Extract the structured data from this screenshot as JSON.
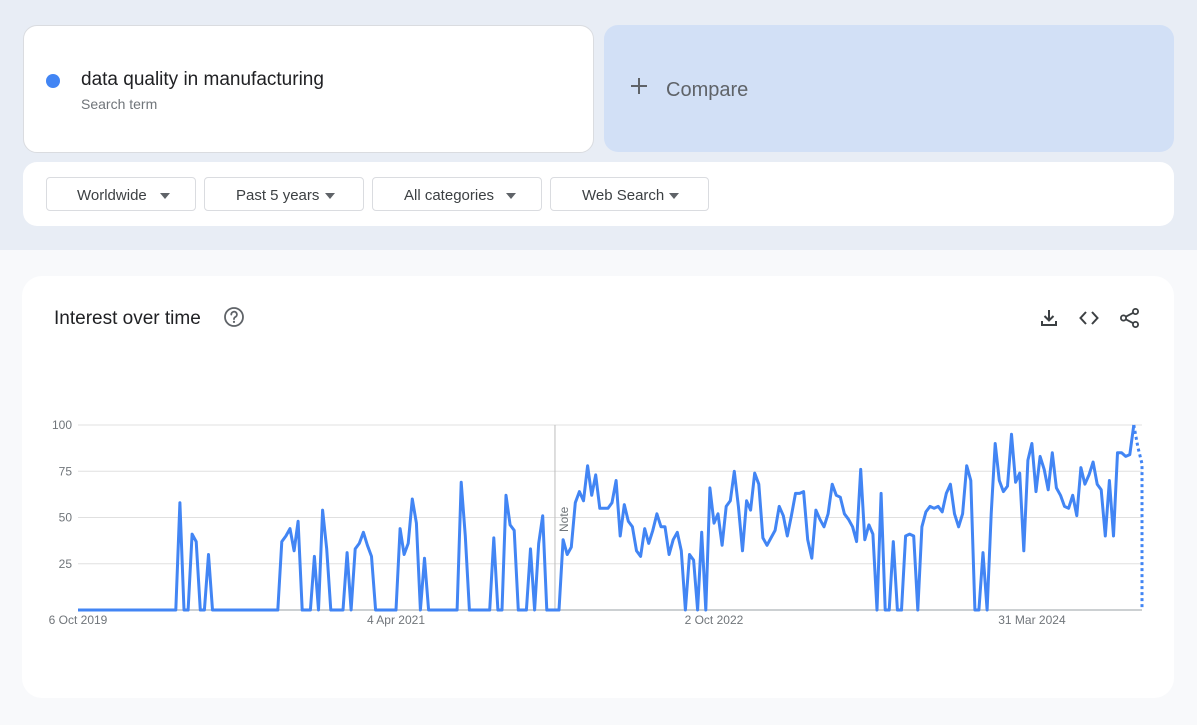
{
  "search_term": {
    "name": "data quality in manufacturing",
    "kind": "Search term",
    "color": "#4285f4"
  },
  "compare": {
    "label": "Compare"
  },
  "filters": [
    {
      "label": "Worldwide"
    },
    {
      "label": "Past 5 years"
    },
    {
      "label": "All categories"
    },
    {
      "label": "Web Search"
    }
  ],
  "chart_panel": {
    "title": "Interest over time",
    "icons": [
      "help-icon",
      "download-icon",
      "embed-code-icon",
      "share-icon"
    ]
  },
  "chart_data": {
    "type": "line",
    "ylim": [
      0,
      100
    ],
    "yticks": [
      "100",
      "75",
      "50",
      "25"
    ],
    "xticks": [
      {
        "label": "6 Oct 2019",
        "index": 0
      },
      {
        "label": "4 Apr 2021",
        "index": 78
      },
      {
        "label": "2 Oct 2022",
        "index": 156
      },
      {
        "label": "31 Mar 2024",
        "index": 234
      }
    ],
    "note": {
      "label": "Note",
      "index": 117
    },
    "partial_from_index": 259,
    "grid": true,
    "series": [
      {
        "color": "#4285f4",
        "values": [
          0,
          0,
          0,
          0,
          0,
          0,
          0,
          0,
          0,
          0,
          0,
          0,
          0,
          0,
          0,
          0,
          0,
          0,
          0,
          0,
          0,
          0,
          0,
          0,
          0,
          58,
          0,
          0,
          41,
          37,
          0,
          0,
          30,
          0,
          0,
          0,
          0,
          0,
          0,
          0,
          0,
          0,
          0,
          0,
          0,
          0,
          0,
          0,
          0,
          0,
          37,
          40,
          44,
          32,
          48,
          0,
          0,
          0,
          29,
          0,
          54,
          33,
          0,
          0,
          0,
          0,
          31,
          0,
          33,
          36,
          42,
          35,
          29,
          0,
          0,
          0,
          0,
          0,
          0,
          44,
          30,
          36,
          60,
          47,
          0,
          28,
          0,
          0,
          0,
          0,
          0,
          0,
          0,
          0,
          69,
          40,
          0,
          0,
          0,
          0,
          0,
          0,
          39,
          0,
          0,
          62,
          46,
          43,
          0,
          0,
          0,
          33,
          0,
          36,
          51,
          0,
          0,
          0,
          0,
          38,
          30,
          34,
          58,
          64,
          59,
          78,
          62,
          73,
          55,
          55,
          55,
          58,
          70,
          40,
          57,
          48,
          45,
          32,
          29,
          44,
          36,
          43,
          52,
          45,
          45,
          30,
          38,
          42,
          32,
          0,
          30,
          27,
          0,
          42,
          0,
          66,
          47,
          52,
          35,
          56,
          59,
          75,
          56,
          32,
          59,
          54,
          74,
          68,
          39,
          35,
          39,
          43,
          56,
          51,
          40,
          51,
          63,
          63,
          64,
          38,
          28,
          54,
          49,
          45,
          52,
          68,
          62,
          61,
          52,
          49,
          45,
          37,
          76,
          38,
          46,
          41,
          0,
          63,
          0,
          0,
          37,
          0,
          0,
          40,
          41,
          40,
          0,
          45,
          53,
          56,
          55,
          56,
          53,
          63,
          68,
          52,
          45,
          52,
          78,
          70,
          0,
          0,
          31,
          0,
          52,
          90,
          70,
          64,
          67,
          95,
          69,
          74,
          32,
          81,
          90,
          64,
          83,
          76,
          65,
          85,
          66,
          62,
          56,
          55,
          62,
          51,
          77,
          68,
          73,
          80,
          68,
          65,
          40,
          70,
          40,
          85,
          85,
          83,
          84,
          100,
          88,
          79
        ]
      }
    ]
  }
}
